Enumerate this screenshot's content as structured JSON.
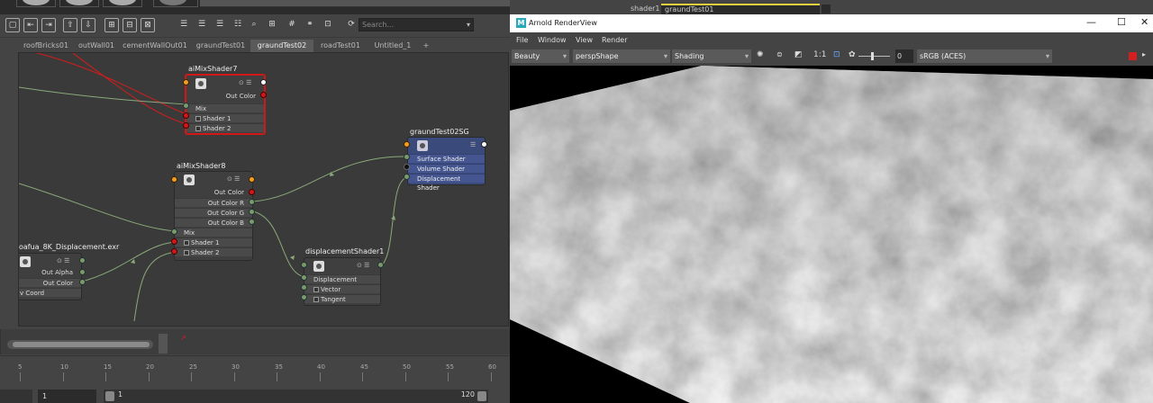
{
  "node_editor": {
    "search": {
      "placeholder": "Search..."
    },
    "tabs": [
      {
        "label": "roofBricks01",
        "active": false
      },
      {
        "label": "outWall01",
        "active": false
      },
      {
        "label": "cementWallOut01",
        "active": false
      },
      {
        "label": "graundTest01",
        "active": false
      },
      {
        "label": "graundTest02",
        "active": true
      },
      {
        "label": "roadTest01",
        "active": false
      },
      {
        "label": "Untitled_1",
        "active": false
      },
      {
        "label": "+",
        "active": false
      }
    ],
    "nodes": {
      "mix7": {
        "title": "aiMixShader7",
        "out": "Out Color",
        "inputs": [
          "Mix",
          "Shader 1",
          "Shader 2"
        ]
      },
      "mix8": {
        "title": "aiMixShader8",
        "outs": [
          "Out Color",
          "Out Color R",
          "Out Color G",
          "Out Color B"
        ],
        "inputs": [
          "Mix",
          "Shader 1",
          "Shader 2"
        ]
      },
      "sg": {
        "title": "graundTest02SG",
        "inputs": [
          "Surface Shader",
          "Volume Shader",
          "Displacement Shader"
        ]
      },
      "disp": {
        "title": "displacementShader1",
        "inputs": [
          "Displacement",
          "Vector Displacement",
          "Tangent"
        ]
      },
      "file": {
        "title": "oafua_8K_Displacement.exr",
        "outs": [
          "Out Alpha",
          "Out Color"
        ],
        "inputs": [
          "v Coord"
        ]
      }
    },
    "top_strip": {
      "field_a": "shader1",
      "field_b": "graundTest01"
    }
  },
  "timeline": {
    "ticks": [
      "5",
      "10",
      "15",
      "20",
      "25",
      "30",
      "35",
      "40",
      "45",
      "50",
      "55",
      "60"
    ],
    "current_frame": "1",
    "range_start": "1",
    "range_end": "120"
  },
  "renderview": {
    "title": "Arnold RenderView",
    "logo": "M",
    "menu": [
      "File",
      "Window",
      "View",
      "Render"
    ],
    "toolbar": {
      "aov": "Beauty",
      "camera": "perspShape",
      "mode": "Shading",
      "ratio": "1:1",
      "exposure": "0",
      "colorspace": "sRGB (ACES)"
    },
    "window_buttons": {
      "minimize": "—",
      "maximize": "☐",
      "close": "✕"
    },
    "stop_color": "#d02020"
  }
}
